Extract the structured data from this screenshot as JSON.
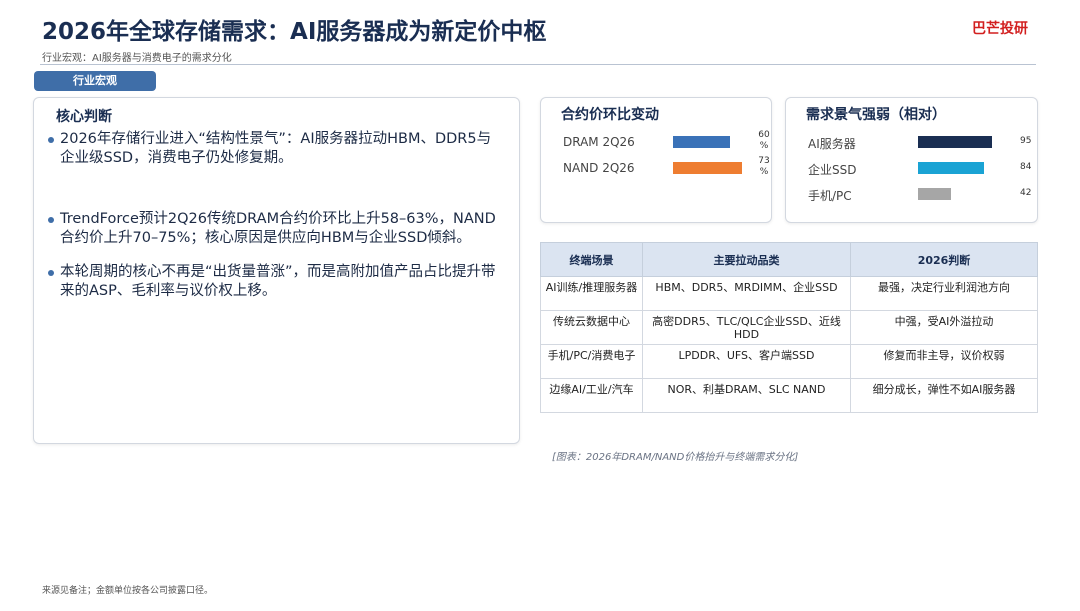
{
  "header": {
    "title": "2026年全球存储需求：AI服务器成为新定价中枢",
    "brand": "巴芒投研",
    "subtitle": "行业宏观：AI服务器与消费电子的需求分化"
  },
  "section_tag": "行业宏观",
  "core": {
    "heading": "核心判断",
    "bullets": [
      "2026年存储行业进入“结构性景气”：AI服务器拉动HBM、DDR5与企业级SSD，消费电子仍处修复期。",
      "TrendForce预计2Q26传统DRAM合约价环比上升58–63%，NAND合约价上升70–75%；核心原因是供应向HBM与企业SSD倾斜。",
      "本轮周期的核心不再是“出货量普涨”，而是高附加值产品占比提升带来的ASP、毛利率与议价权上移。"
    ]
  },
  "price_change": {
    "heading": "合约价环比变动",
    "items": [
      {
        "label": "DRAM 2Q26",
        "value": 60,
        "value_label": "60\n%",
        "color": "#3a72b8"
      },
      {
        "label": "NAND 2Q26",
        "value": 73,
        "value_label": "73\n%",
        "color": "#ee7d31"
      }
    ],
    "max": 80
  },
  "demand": {
    "heading": "需求景气强弱（相对）",
    "items": [
      {
        "label": "AI服务器",
        "value": 95,
        "value_label": "95",
        "color": "#1a2e52"
      },
      {
        "label": "企业SSD",
        "value": 84,
        "value_label": "84",
        "color": "#1aa3d4"
      },
      {
        "label": "手机/PC",
        "value": 42,
        "value_label": "42",
        "color": "#a6a6a6"
      }
    ],
    "max": 100
  },
  "table": {
    "headers": [
      "终端场景",
      "主要拉动品类",
      "2026判断"
    ],
    "rows": [
      [
        "AI训练/推理服务器",
        "HBM、DDR5、MRDIMM、企业SSD",
        "最强，决定行业利润池方向"
      ],
      [
        "传统云数据中心",
        "高密DDR5、TLC/QLC企业SSD、近线HDD",
        "中强，受AI外溢拉动"
      ],
      [
        "手机/PC/消费电子",
        "LPDDR、UFS、客户端SSD",
        "修复而非主导，议价权弱"
      ],
      [
        "边缘AI/工业/汽车",
        "NOR、利基DRAM、SLC NAND",
        "细分成长，弹性不如AI服务器"
      ]
    ]
  },
  "caption": "[图表：2026年DRAM/NAND价格抬升与终端需求分化]",
  "footer": "来源见备注；金额单位按各公司披露口径。"
}
